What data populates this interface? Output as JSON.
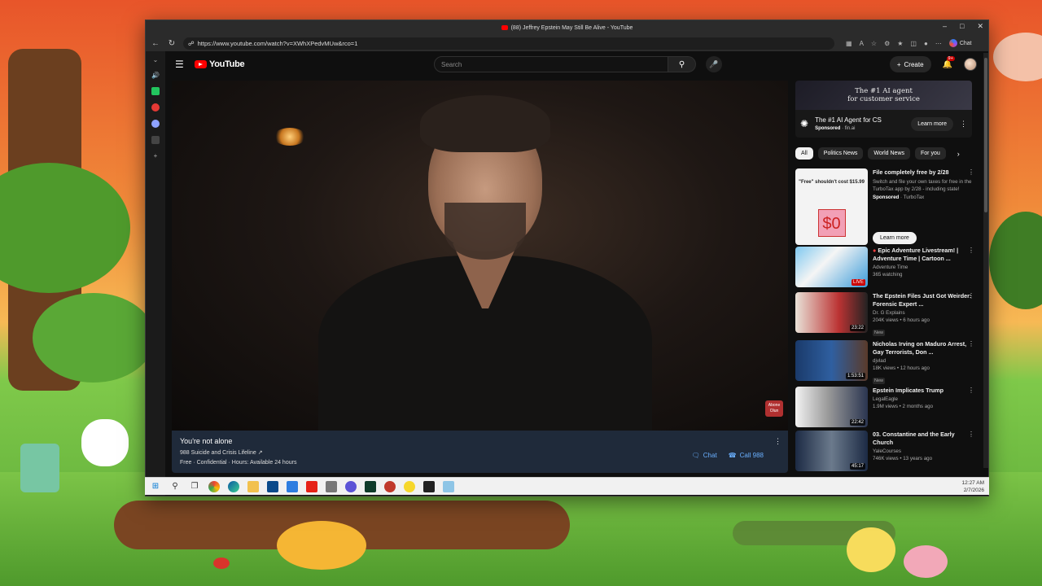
{
  "window": {
    "title": "(88) Jeffrey Epstein May Still Be Alive - YouTube",
    "url": "https://www.youtube.com/watch?v=XWhXPedvMUw&rco=1",
    "chat_label": "Chat"
  },
  "youtube": {
    "logo_text": "YouTube",
    "search_placeholder": "Search",
    "create_label": "Create",
    "notif_badge": "9+"
  },
  "crisis_panel": {
    "heading": "You're not alone",
    "line1": "988 Suicide and Crisis Lifeline ↗",
    "line2": "Free · Confidential · Hours: Available 24 hours",
    "chat_label": "Chat",
    "call_label": "Call 988"
  },
  "player": {
    "watermark": "Abone Olun"
  },
  "ad": {
    "banner_line1": "The #1 AI agent",
    "banner_line2": "for customer service",
    "title": "The #1 AI Agent for CS",
    "sponsor": "Sponsored",
    "domain": "fin.ai",
    "cta": "Learn more"
  },
  "chips": [
    "All",
    "Politics News",
    "World News",
    "For you"
  ],
  "sponsored_video": {
    "title": "File completely free by 2/28",
    "desc": "Switch and file your own taxes for free in the TurboTax app by 2/28 - including state!",
    "sponsor": "Sponsored",
    "advertiser": "TurboTax",
    "cta": "Learn more",
    "thumb_line": "\"Free\" shouldn't cost $15.99",
    "thumb_price": "$0"
  },
  "videos": [
    {
      "title": "Epic Adventure Livestream! | Adventure Time | Cartoon ...",
      "channel": "Adventure Time",
      "stats": "365 watching",
      "badge": "LIVE",
      "tag": ""
    },
    {
      "title": "The Epstein Files Just Got Weirder: Forensic Expert ...",
      "channel": "Dr. G Explains",
      "stats": "204K views • 6 hours ago",
      "badge": "23:22",
      "tag": "New"
    },
    {
      "title": "Nicholas Irving on Maduro Arrest, Gay Terrorists, Don ...",
      "channel": "djvlad",
      "stats": "18K views • 12 hours ago",
      "badge": "1:53:51",
      "tag": "New"
    },
    {
      "title": "Epstein Implicates Trump",
      "channel": "LegalEagle",
      "stats": "1.9M views • 2 months ago",
      "badge": "22:42",
      "tag": ""
    },
    {
      "title": "03. Constantine and the Early Church",
      "channel": "YaleCourses",
      "stats": "746K views • 13 years ago",
      "badge": "45:17",
      "tag": ""
    }
  ],
  "taskbar": {
    "time": "12:27 AM",
    "date": "2/7/2026"
  }
}
